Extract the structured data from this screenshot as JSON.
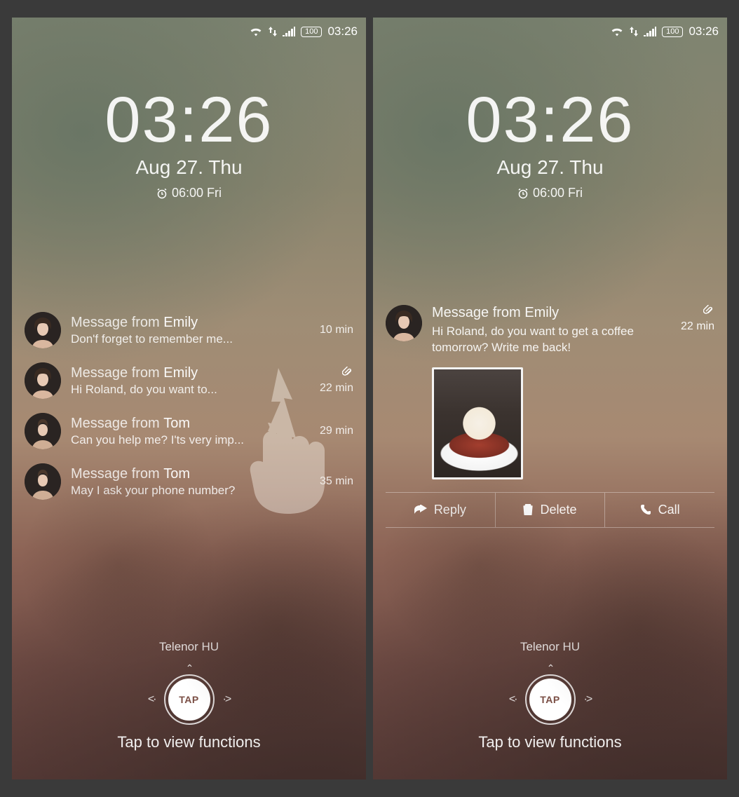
{
  "statusbar": {
    "battery": "100",
    "time": "03:26"
  },
  "clock": {
    "time": "03:26",
    "date": "Aug 27. Thu",
    "alarm": "06:00 Fri"
  },
  "notifications": [
    {
      "from_label": "Message from",
      "name": "Emily",
      "preview": "Don'f forget to remember me...",
      "time": "10 min",
      "attachment": false,
      "avatar": "f"
    },
    {
      "from_label": "Message from",
      "name": "Emily",
      "preview": "Hi Roland, do you want to...",
      "time": "22 min",
      "attachment": true,
      "avatar": "f"
    },
    {
      "from_label": "Message from",
      "name": "Tom",
      "preview": "Can you help me? I'ts very imp...",
      "time": "29 min",
      "attachment": false,
      "avatar": "m"
    },
    {
      "from_label": "Message from",
      "name": "Tom",
      "preview": "May I ask your phone number?",
      "time": "35 min",
      "attachment": false,
      "avatar": "m"
    }
  ],
  "expanded": {
    "from_label": "Message from",
    "name": "Emily",
    "body": "Hi Roland, do you want to get a coffee tomorrow? Write me back!",
    "time": "22 min",
    "attachment": true,
    "actions": {
      "reply": "Reply",
      "delete": "Delete",
      "call": "Call"
    }
  },
  "carrier": "Telenor HU",
  "tap": {
    "label": "TAP",
    "hint": "Tap to view functions"
  }
}
